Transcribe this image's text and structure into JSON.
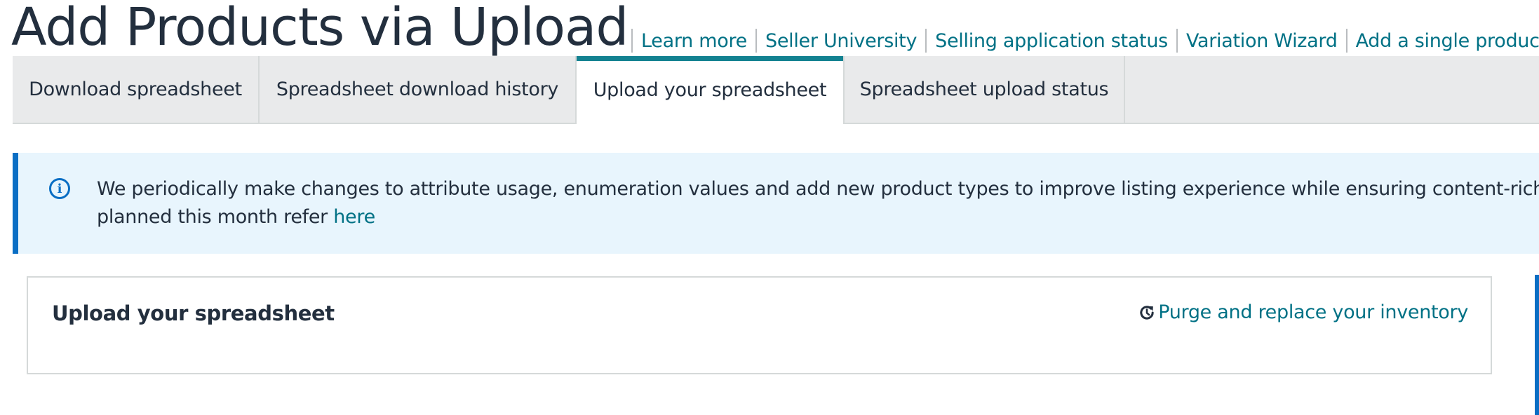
{
  "header": {
    "title": "Add Products via Upload",
    "links": [
      {
        "label": "Learn more"
      },
      {
        "label": "Seller University"
      },
      {
        "label": "Selling application status"
      },
      {
        "label": "Variation Wizard"
      },
      {
        "label": "Add a single product"
      }
    ]
  },
  "tabs": [
    {
      "label": "Download spreadsheet",
      "active": false
    },
    {
      "label": "Spreadsheet download history",
      "active": false
    },
    {
      "label": "Upload your spreadsheet",
      "active": true
    },
    {
      "label": "Spreadsheet upload status",
      "active": false
    }
  ],
  "banner": {
    "icon": "info-icon",
    "line1": "We periodically make changes to attribute usage, enumeration values and add new product types to improve listing experience while ensuring content-rich product",
    "line2_prefix": "planned this month refer ",
    "link_label": "here"
  },
  "card": {
    "title": "Upload your spreadsheet",
    "purge_icon": "history-clock-icon",
    "purge_label": "Purge and replace your inventory"
  },
  "colors": {
    "text": "#232f3e",
    "link": "#007185",
    "active_tab_bar": "#138291",
    "info_blue": "#0a6ec4",
    "banner_bg": "#e8f5fd",
    "tab_bg": "#e9eaeb"
  }
}
